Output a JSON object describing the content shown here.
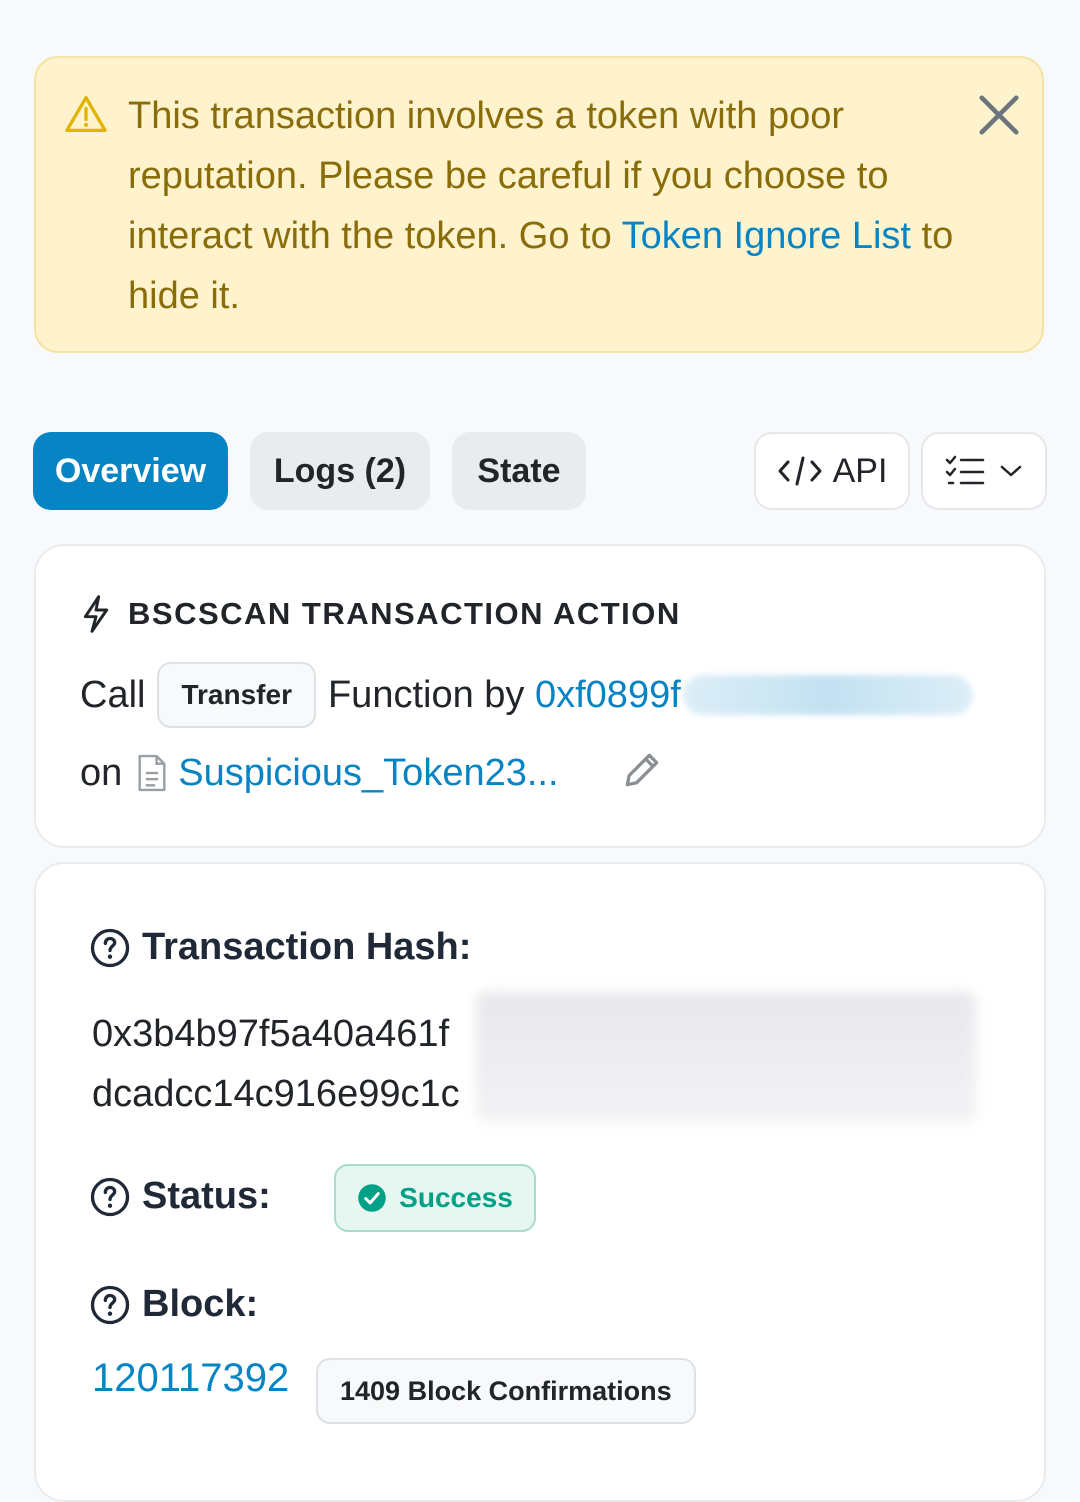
{
  "alert": {
    "text_before": "This transaction involves a token with poor reputation. Please be careful if you choose to interact with the token. Go to ",
    "link": "Token Ignore List",
    "text_after": " to hide it."
  },
  "tabs": [
    {
      "label": "Overview",
      "active": true
    },
    {
      "label": "Logs (2)",
      "active": false
    },
    {
      "label": "State",
      "active": false
    }
  ],
  "toolbar": {
    "api_label": "API"
  },
  "action": {
    "heading": "BSCSCAN TRANSACTION ACTION",
    "call": "Call",
    "function_chip": "Transfer",
    "function_by": "Function by",
    "from_address": "0xf0899f",
    "on": "on",
    "token_link": "Suspicious_Token23..."
  },
  "details": {
    "hash_label": "Transaction Hash:",
    "hash_line1": "0x3b4b97f5a40a461f",
    "hash_line2": "dcadcc14c916e99c1c",
    "status_label": "Status:",
    "status_value": "Success",
    "block_label": "Block:",
    "block_number": "120117392",
    "confirmations": "1409 Block Confirmations"
  },
  "colors": {
    "accent": "#0784c3",
    "warning_bg": "#fff3cd",
    "success": "#00a186"
  }
}
